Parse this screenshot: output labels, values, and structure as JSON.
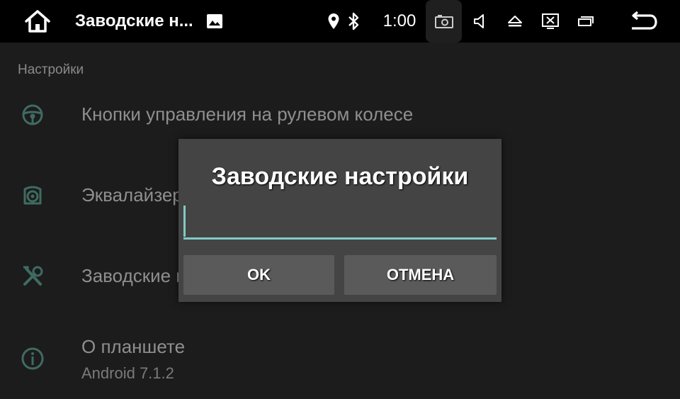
{
  "status_bar": {
    "app_title": "Заводские н...",
    "time": "1:00",
    "icons": [
      "home-icon",
      "image-icon",
      "location-icon",
      "bluetooth-icon",
      "screenshot-icon",
      "volume-icon",
      "eject-icon",
      "close-app-icon",
      "recent-apps-icon",
      "back-icon"
    ]
  },
  "settings": {
    "section_header": "Настройки",
    "items": [
      {
        "label": "Кнопки управления на рулевом колесе",
        "icon": "steering-wheel-icon"
      },
      {
        "label": "Эквалайзер",
        "icon": "equalizer-icon"
      },
      {
        "label": "Заводские настройки",
        "icon": "wrench-icon"
      },
      {
        "label": "О планшете",
        "sublabel": "Android 7.1.2",
        "icon": "info-icon"
      }
    ]
  },
  "dialog": {
    "title": "Заводские настройки",
    "input_value": "",
    "ok_label": "OK",
    "cancel_label": "ОТМЕНА"
  },
  "colors": {
    "accent": "#80cbc4",
    "dialog_bg": "#444444",
    "button_bg": "#5a5a5a",
    "icon_tint": "#3f6b62"
  }
}
